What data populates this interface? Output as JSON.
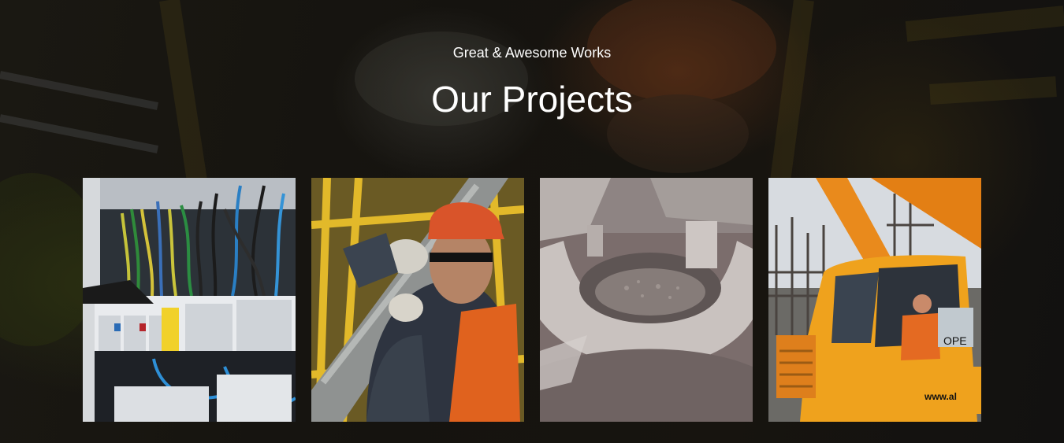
{
  "header": {
    "subtitle": "Great & Awesome Works",
    "title": "Our Projects"
  },
  "projects": [
    {
      "image": "electrical-panel-wiring-photo"
    },
    {
      "image": "worker-carrying-pipe-photo"
    },
    {
      "image": "concrete-chute-photo"
    },
    {
      "image": "crane-cab-operator-photo"
    }
  ],
  "crane_text": {
    "cab_label": "OPE",
    "side_label": "www.al"
  },
  "colors": {
    "background": "#141414",
    "text": "#ffffff",
    "accent_orange": "#e98a1c",
    "hardhat": "#d9542a"
  }
}
